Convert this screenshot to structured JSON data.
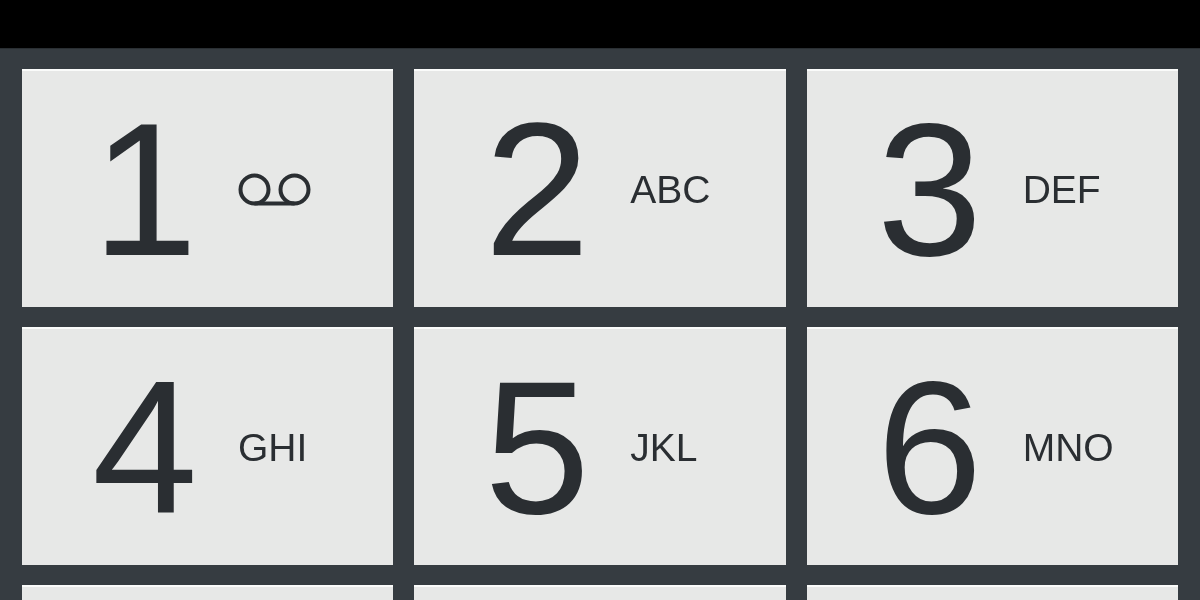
{
  "keypad": {
    "keys": [
      {
        "kind": "icon",
        "digit": "1"
      },
      {
        "kind": "letters",
        "digit": "2",
        "letters": "ABC"
      },
      {
        "kind": "letters",
        "digit": "3",
        "letters": "DEF"
      },
      {
        "kind": "letters",
        "digit": "4",
        "letters": "GHI"
      },
      {
        "kind": "letters",
        "digit": "5",
        "letters": "JKL"
      },
      {
        "kind": "letters",
        "digit": "6",
        "letters": "MNO"
      },
      {
        "kind": "blank"
      },
      {
        "kind": "blank"
      },
      {
        "kind": "blank"
      }
    ]
  }
}
